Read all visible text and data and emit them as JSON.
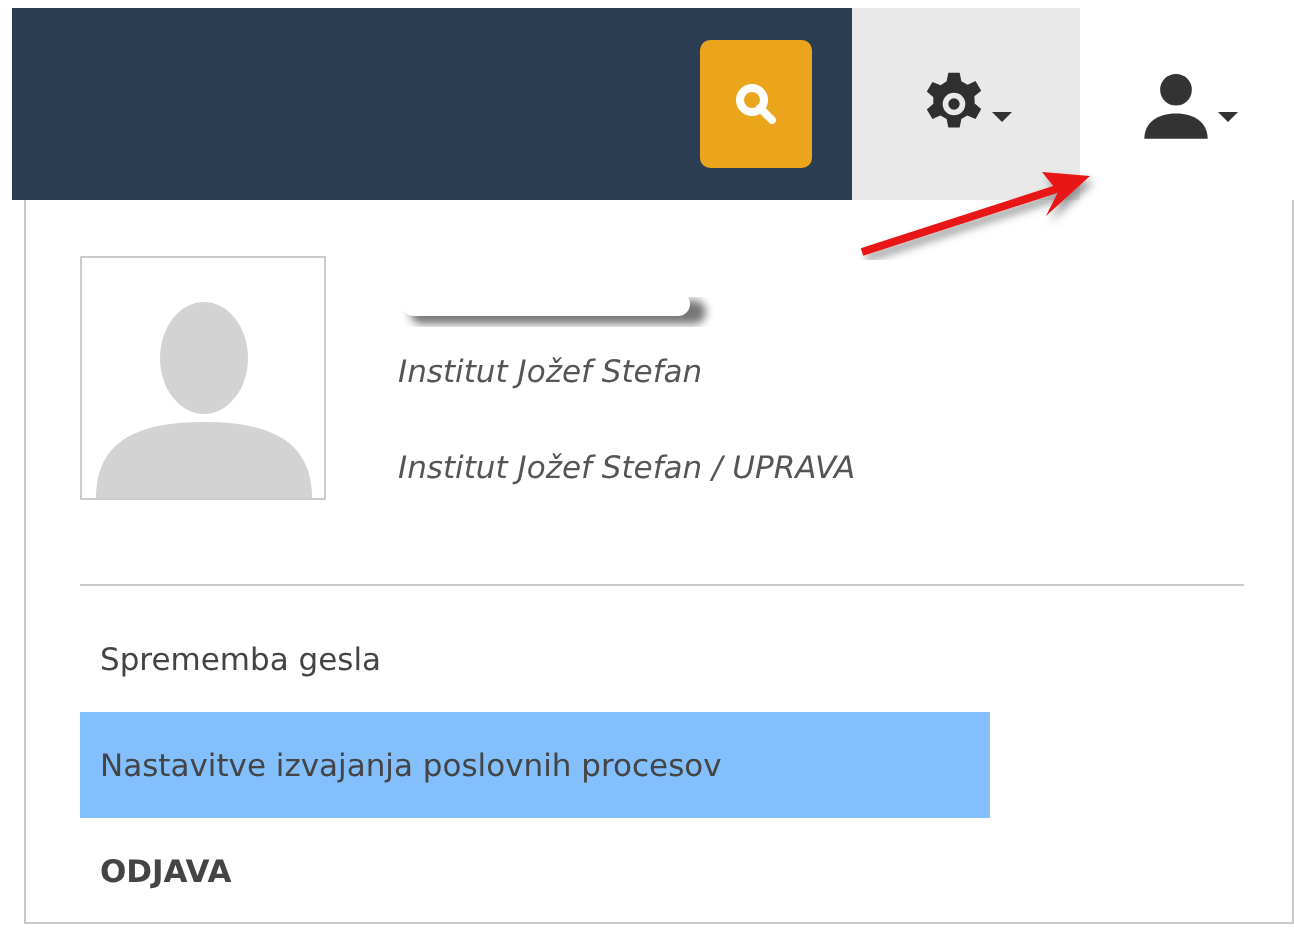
{
  "toolbar": {
    "buttons": [
      {
        "kind": "search"
      },
      {
        "kind": "settings",
        "selected": false
      },
      {
        "kind": "user",
        "selected": true
      }
    ]
  },
  "user_menu": {
    "organization": "Institut Jožef Stefan",
    "department": "Institut Jožef Stefan / UPRAVA",
    "items": [
      {
        "label": "Sprememba gesla",
        "kind": "link",
        "selected": false
      },
      {
        "label": "Nastavitve izvajanja poslovnih procesov",
        "kind": "link",
        "selected": true
      },
      {
        "label": "ODJAVA",
        "kind": "logout",
        "selected": false
      }
    ]
  }
}
